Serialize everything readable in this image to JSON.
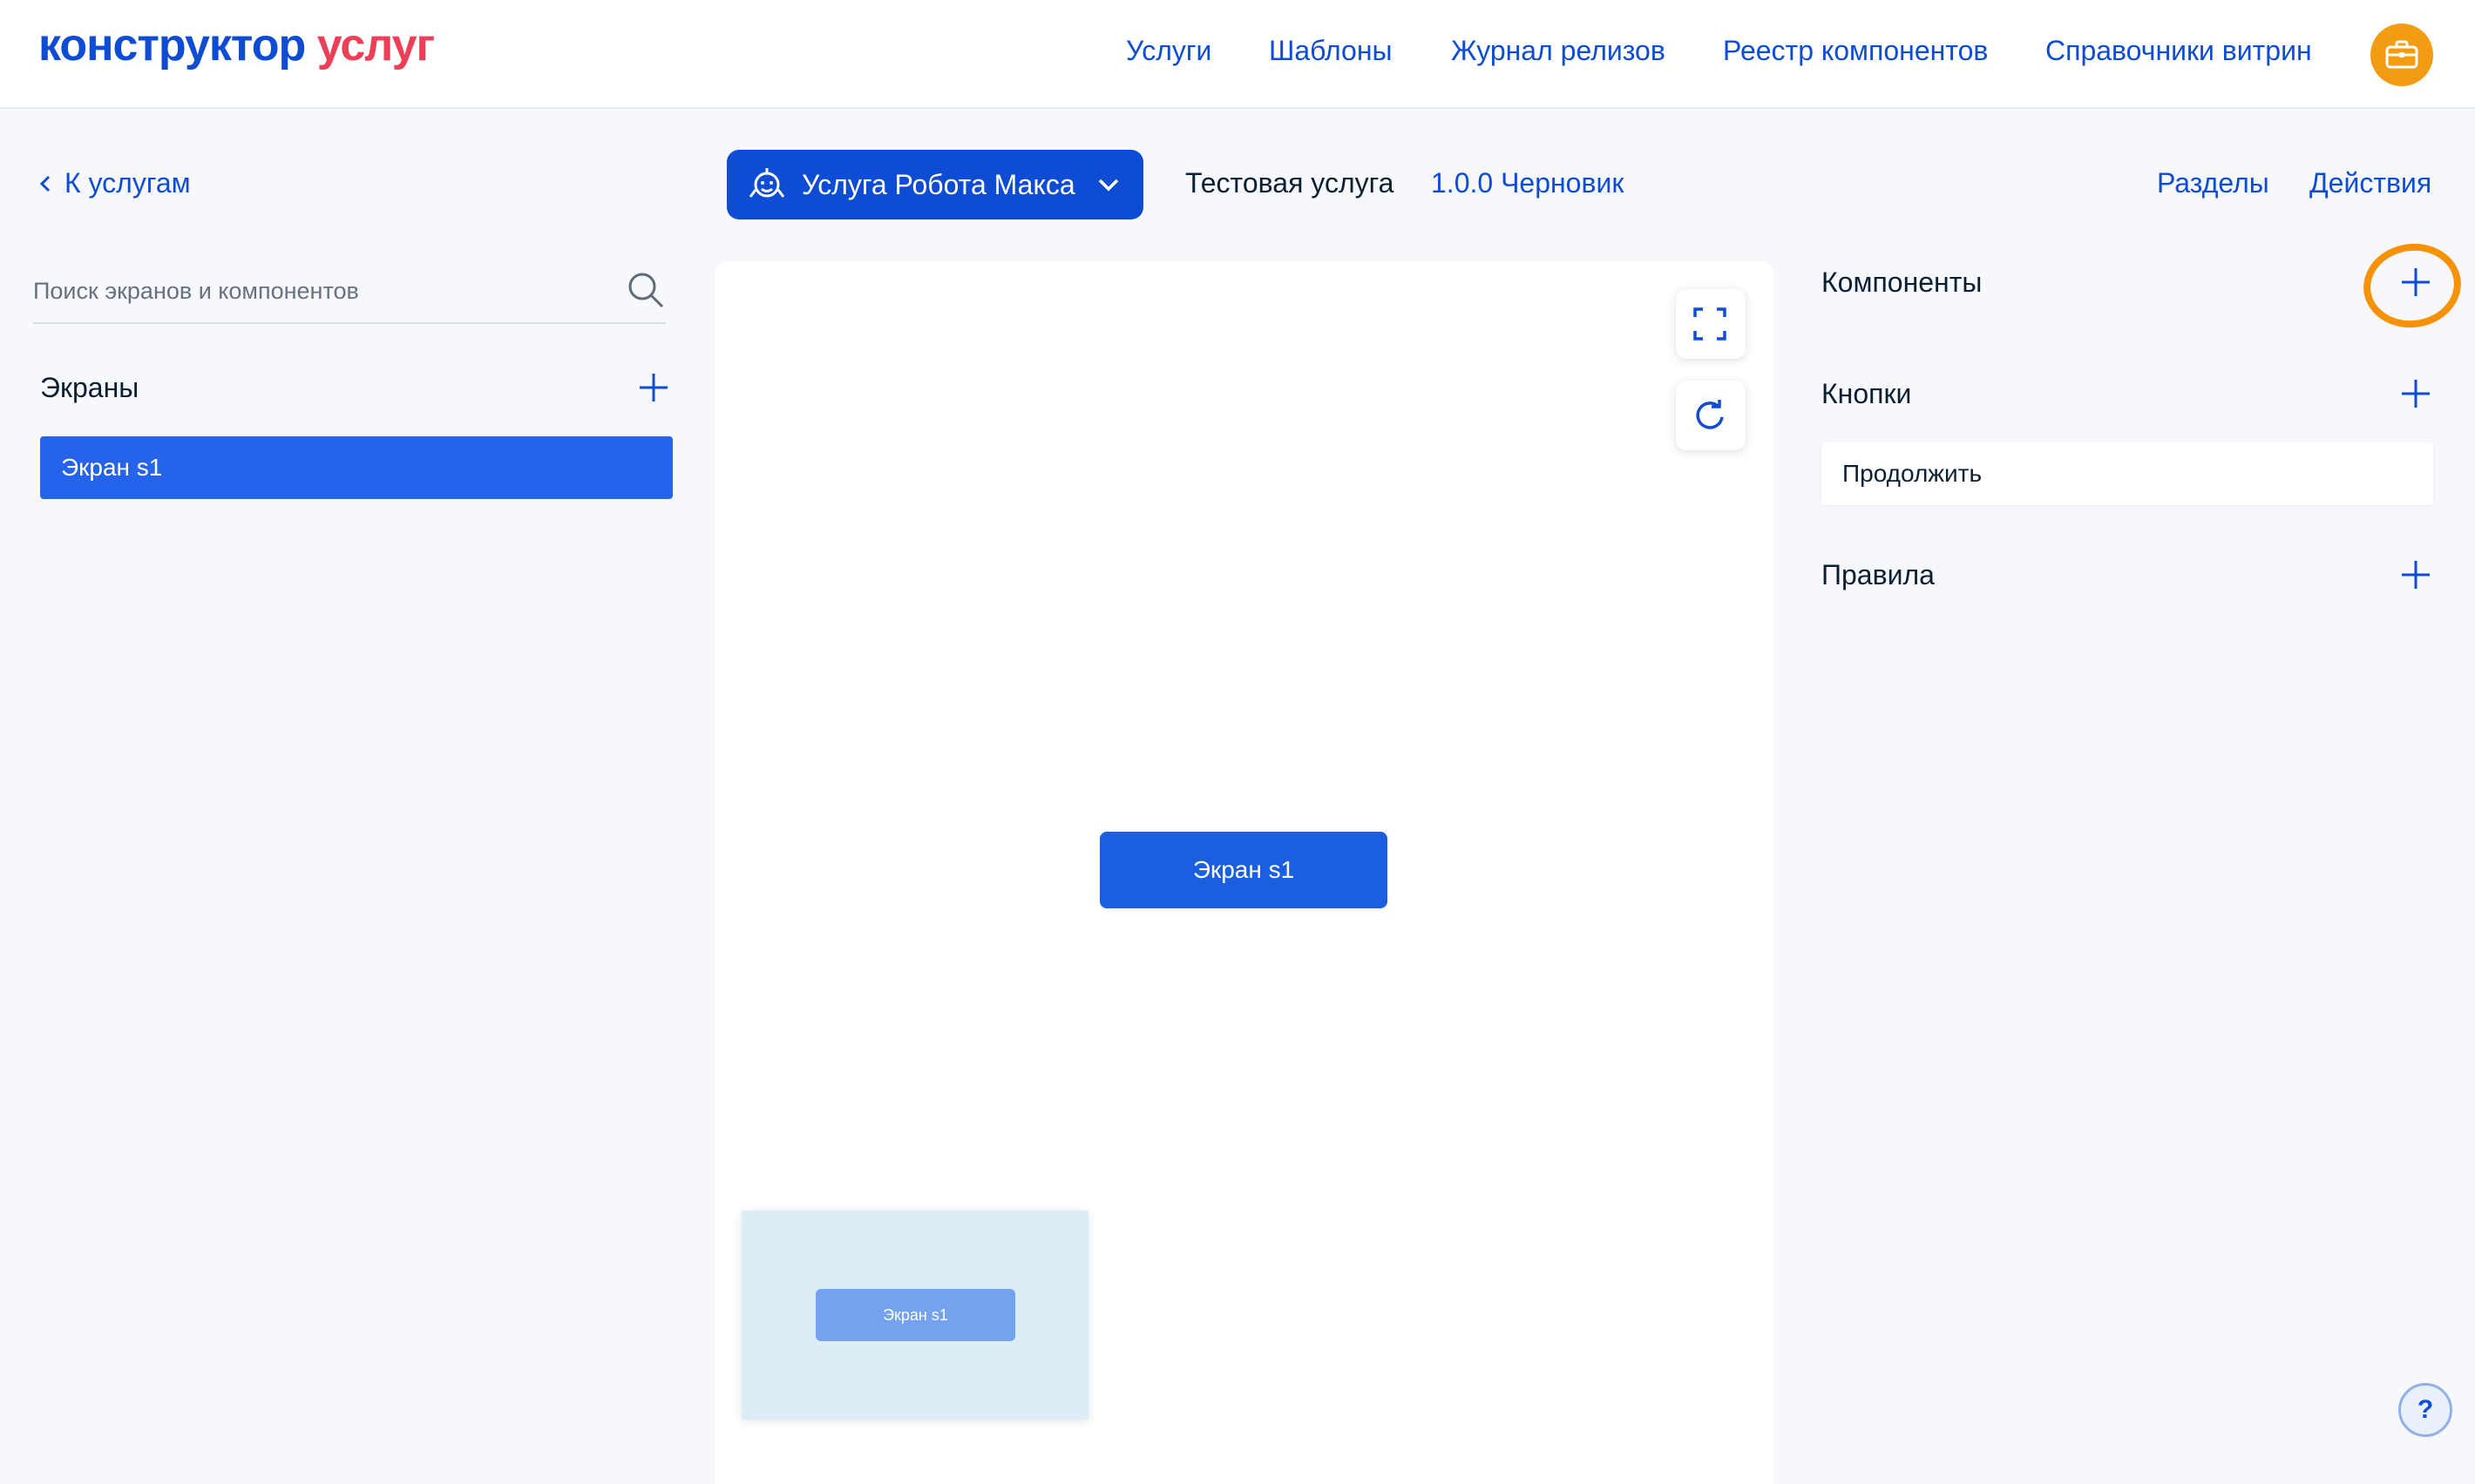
{
  "header": {
    "logo_part1": "конструктор",
    "logo_part2": "услуг",
    "nav": [
      "Услуги",
      "Шаблоны",
      "Журнал релизов",
      "Реестр компонентов",
      "Справочники витрин"
    ],
    "profile_icon": "briefcase-icon"
  },
  "subheader": {
    "back_label": "К услугам",
    "service_dropdown_label": "Услуга Робота Макса",
    "service_name": "Тестовая услуга",
    "version": "1.0.0 Черновик",
    "sections_link": "Разделы",
    "actions_link": "Действия"
  },
  "left_panel": {
    "search_placeholder": "Поиск экранов и компонентов",
    "screens_title": "Экраны",
    "screens": [
      "Экран s1"
    ]
  },
  "canvas": {
    "node_label": "Экран s1",
    "minimap_node_label": "Экран s1"
  },
  "right_panel": {
    "components_title": "Компоненты",
    "buttons_title": "Кнопки",
    "buttons": [
      "Продолжить"
    ],
    "rules_title": "Правила"
  },
  "help_label": "?",
  "colors": {
    "accent": "#0d4cd3",
    "selected": "#2563eb",
    "logo_red": "#ee3f58",
    "highlight": "#f5920a",
    "background": "#f6f8fc"
  }
}
